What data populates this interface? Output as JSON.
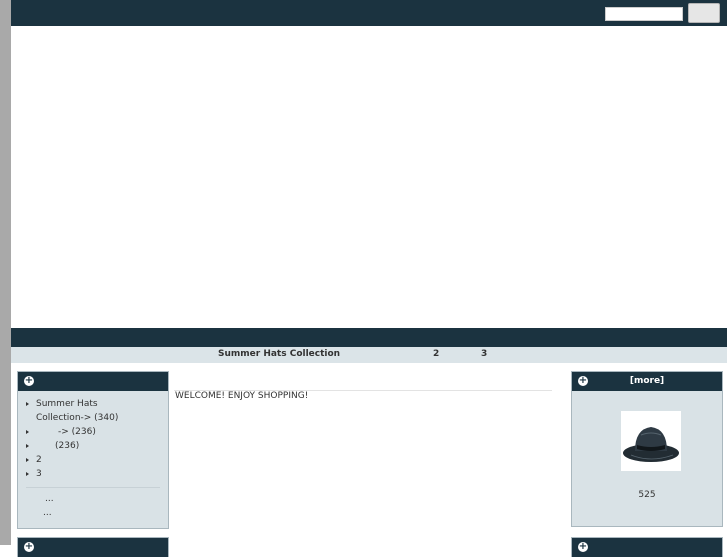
{
  "search": {
    "placeholder": "",
    "button_label": ""
  },
  "catbar": {
    "item1": "Summer Hats Collection",
    "item2": "2",
    "item3": "3"
  },
  "sidebar": {
    "categories": [
      {
        "label": "Summer Hats Collection-> (340)"
      },
      {
        "label": "-> (236)"
      },
      {
        "label": "(236)"
      },
      {
        "label": "2"
      },
      {
        "label": "3"
      }
    ],
    "sub_links": [
      "...",
      "..."
    ]
  },
  "main": {
    "welcome": "WELCOME! ENJOY SHOPPING!"
  },
  "featured": {
    "more_label": "[more]",
    "count": "525",
    "image": "black-fedora-hat"
  },
  "colors": {
    "header": "#1b3340",
    "box_bg": "#d9e2e6",
    "gutter": "#a9a9a9"
  }
}
